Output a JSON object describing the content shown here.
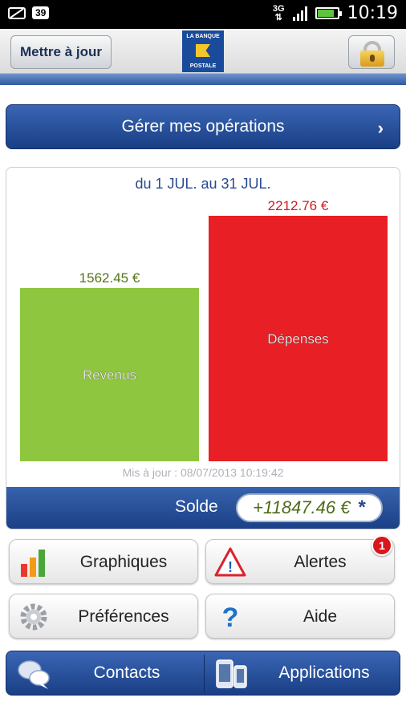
{
  "status": {
    "notification_count": "39",
    "network": "3G",
    "time": "10:19"
  },
  "header": {
    "update_label": "Mettre à jour",
    "logo_top": "LA BANQUE",
    "logo_bottom": "POSTALE"
  },
  "manage": {
    "label": "Gérer mes opérations"
  },
  "summary": {
    "period": "du 1 JUL. au 31 JUL.",
    "updated": "Mis à jour : 08/07/2013 10:19:42",
    "solde_label": "Solde",
    "solde_value": "+11847.46 €",
    "solde_marker": "*"
  },
  "chart_data": {
    "type": "bar",
    "categories": [
      "Revenus",
      "Dépenses"
    ],
    "values": [
      1562.45,
      2212.76
    ],
    "value_labels": [
      "1562.45 €",
      "2212.76 €"
    ],
    "colors": [
      "#8ec63f",
      "#e81f24"
    ]
  },
  "tiles": {
    "graphiques": "Graphiques",
    "alertes": "Alertes",
    "alertes_badge": "1",
    "preferences": "Préférences",
    "aide": "Aide"
  },
  "bottom_nav": {
    "contacts": "Contacts",
    "applications": "Applications"
  }
}
